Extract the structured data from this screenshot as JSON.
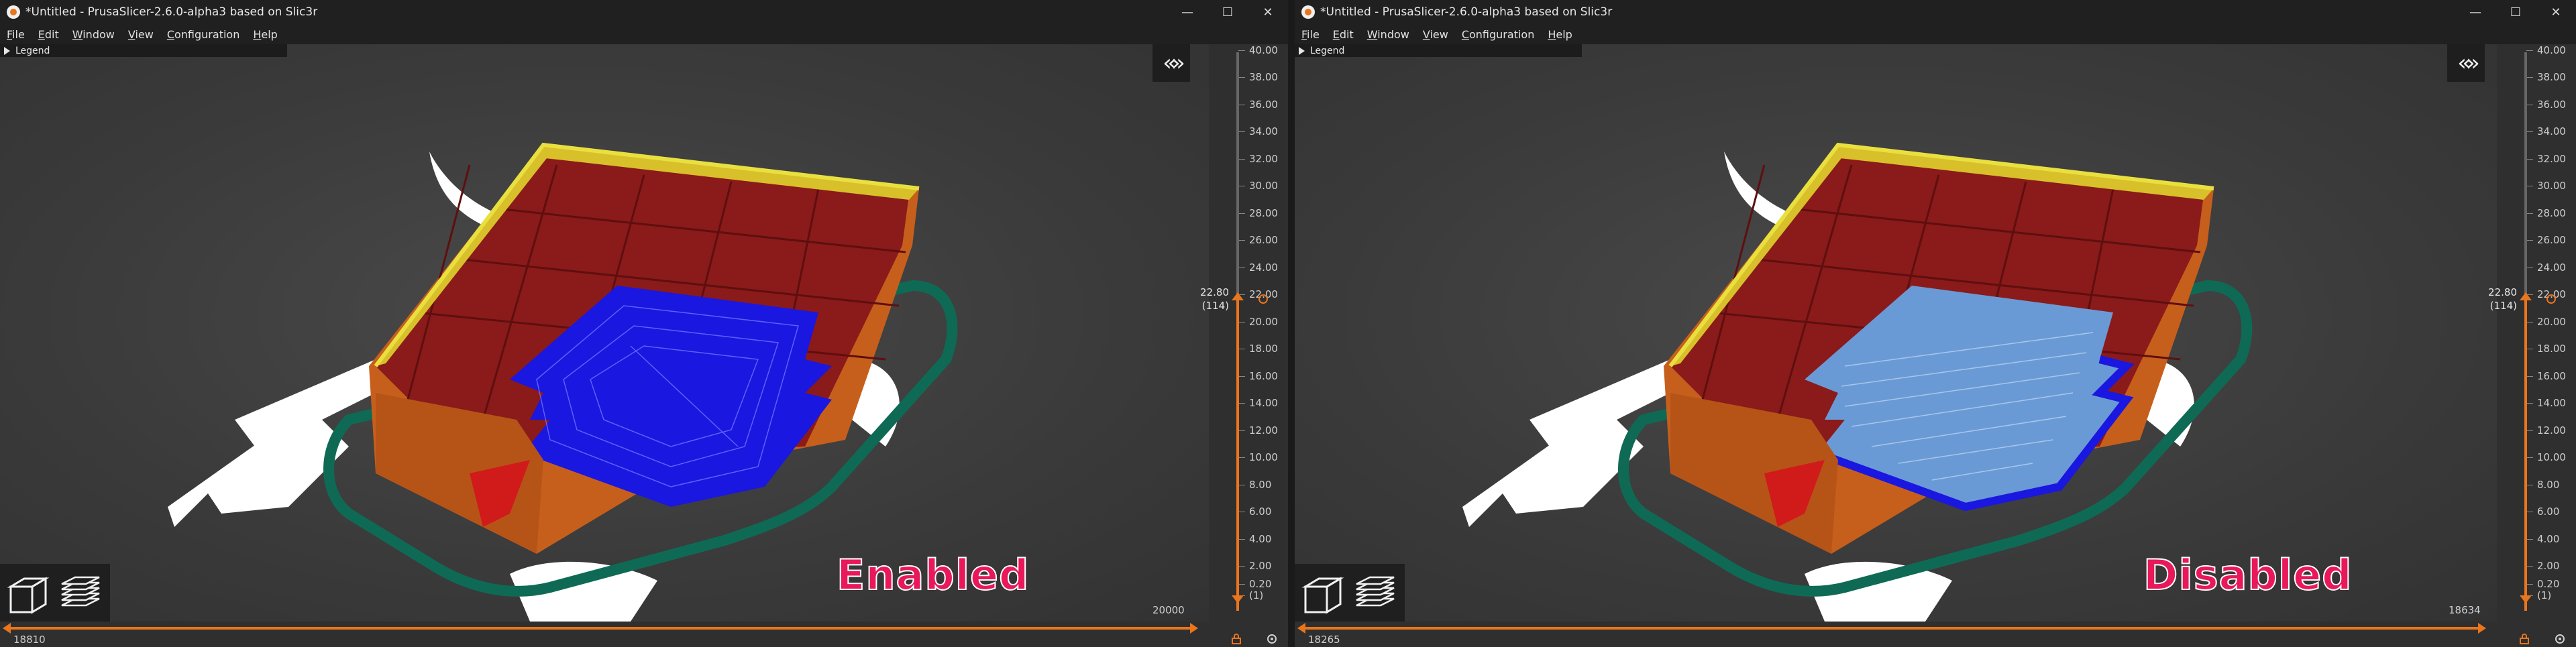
{
  "left": {
    "title": "*Untitled - PrusaSlicer-2.6.0-alpha3 based on Slic3r",
    "menu": [
      "File",
      "Edit",
      "Window",
      "View",
      "Configuration",
      "Help"
    ],
    "legend_label": "Legend",
    "status_label": "Enabled",
    "layer_ticks": [
      "40.00",
      "38.00",
      "36.00",
      "34.00",
      "32.00",
      "30.00",
      "28.00",
      "26.00",
      "24.00",
      "22.00",
      "20.00",
      "18.00",
      "16.00",
      "14.00",
      "12.00",
      "10.00",
      "8.00",
      "6.00",
      "4.00",
      "2.00",
      "0.20"
    ],
    "first_layer_index": "(1)",
    "current_layer_height": "22.80",
    "current_layer_index": "(114)",
    "horizontal_max": "20000",
    "horizontal_current": "18810",
    "infill_color": "#1a17e0"
  },
  "right": {
    "title": "*Untitled - PrusaSlicer-2.6.0-alpha3 based on Slic3r",
    "menu": [
      "File",
      "Edit",
      "Window",
      "View",
      "Configuration",
      "Help"
    ],
    "legend_label": "Legend",
    "status_label": "Disabled",
    "layer_ticks": [
      "40.00",
      "38.00",
      "36.00",
      "34.00",
      "32.00",
      "30.00",
      "28.00",
      "26.00",
      "24.00",
      "22.00",
      "20.00",
      "18.00",
      "16.00",
      "14.00",
      "12.00",
      "10.00",
      "8.00",
      "6.00",
      "4.00",
      "2.00",
      "0.20"
    ],
    "first_layer_index": "(1)",
    "current_layer_height": "22.80",
    "current_layer_index": "(114)",
    "horizontal_max": "18634",
    "horizontal_current": "18265",
    "infill_color": "#6a9ad6"
  },
  "window_controls": {
    "minimize": "—",
    "maximize": "☐",
    "close": "✕"
  },
  "collapse_icon": "«»",
  "colors": {
    "accent": "#e9751d",
    "wall": "#c75f1c",
    "inner_wall": "#8b1a1a",
    "skirt": "#0f6a55",
    "label": "#e8185a"
  }
}
